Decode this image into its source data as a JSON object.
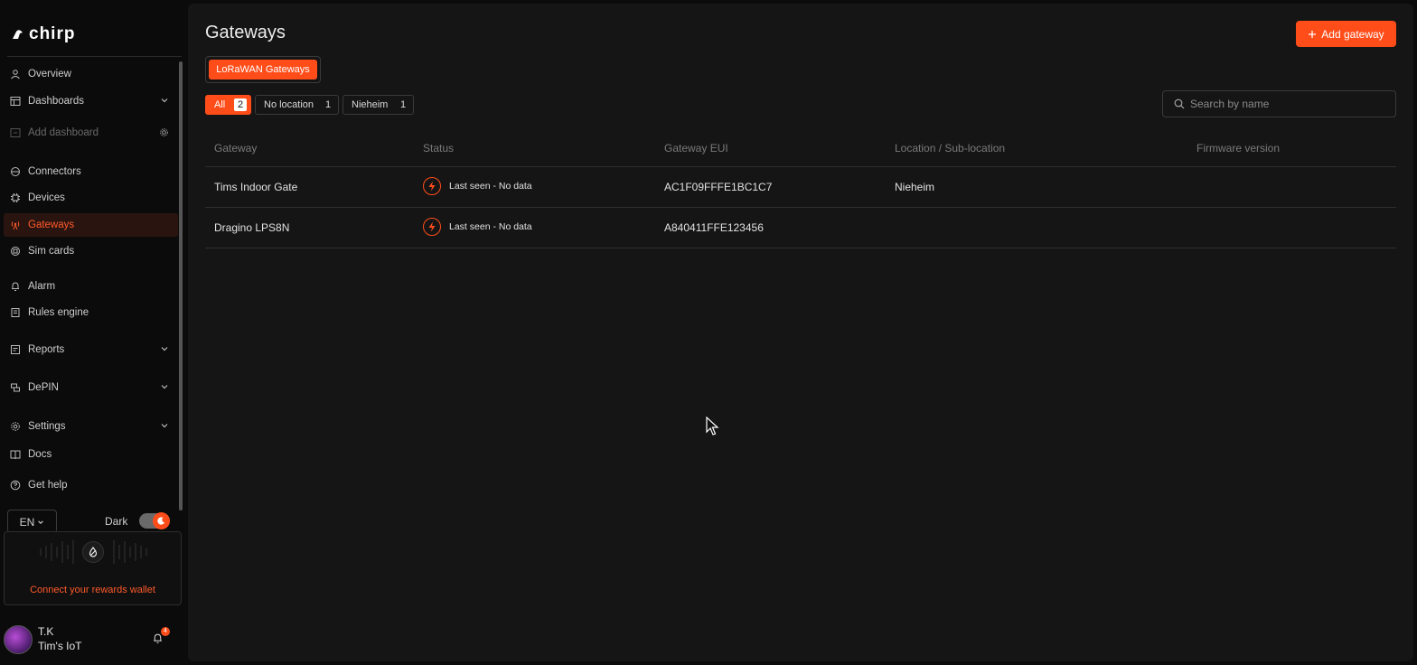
{
  "brand": {
    "name": "chirp",
    "accent": "#ff4d1a"
  },
  "sidebar": {
    "items": [
      {
        "label": "Overview",
        "icon": "user-icon"
      },
      {
        "label": "Dashboards",
        "icon": "dashboard-icon",
        "expandable": true
      },
      {
        "label": "Add dashboard",
        "icon": "add-dashboard-icon",
        "disabled": true
      },
      {
        "label": "Connectors",
        "icon": "connector-icon"
      },
      {
        "label": "Devices",
        "icon": "chip-icon"
      },
      {
        "label": "Gateways",
        "icon": "antenna-icon",
        "active": true
      },
      {
        "label": "Sim cards",
        "icon": "sim-icon"
      },
      {
        "label": "Alarm",
        "icon": "bell-icon"
      },
      {
        "label": "Rules engine",
        "icon": "rules-icon"
      },
      {
        "label": "Reports",
        "icon": "report-icon",
        "expandable": true
      },
      {
        "label": "DePIN",
        "icon": "depin-icon",
        "expandable": true
      },
      {
        "label": "Settings",
        "icon": "gear-icon",
        "expandable": true
      },
      {
        "label": "Docs",
        "icon": "book-icon"
      },
      {
        "label": "Get help",
        "icon": "help-icon"
      }
    ],
    "language": "EN",
    "theme_label": "Dark",
    "wallet_cta": "Connect your rewards wallet",
    "user": {
      "initials": "T.K",
      "org": "Tim's IoT",
      "notifications": "4"
    }
  },
  "main": {
    "title": "Gateways",
    "add_button": "Add gateway",
    "type_tab": "LoRaWAN Gateways",
    "filters": [
      {
        "label": "All",
        "count": "2",
        "active": true
      },
      {
        "label": "No location",
        "count": "1"
      },
      {
        "label": "Nieheim",
        "count": "1"
      }
    ],
    "search": {
      "placeholder": "Search by name"
    },
    "columns": [
      "Gateway",
      "Status",
      "Gateway EUI",
      "Location / Sub-location",
      "Firmware version"
    ],
    "rows": [
      {
        "gateway": "Tims Indoor Gate",
        "status": "Last seen - No data",
        "eui": "AC1F09FFFE1BC1C7",
        "location": "Nieheim",
        "firmware": ""
      },
      {
        "gateway": "Dragino LPS8N",
        "status": "Last seen - No data",
        "eui": "A840411FFE123456",
        "location": "",
        "firmware": ""
      }
    ]
  }
}
